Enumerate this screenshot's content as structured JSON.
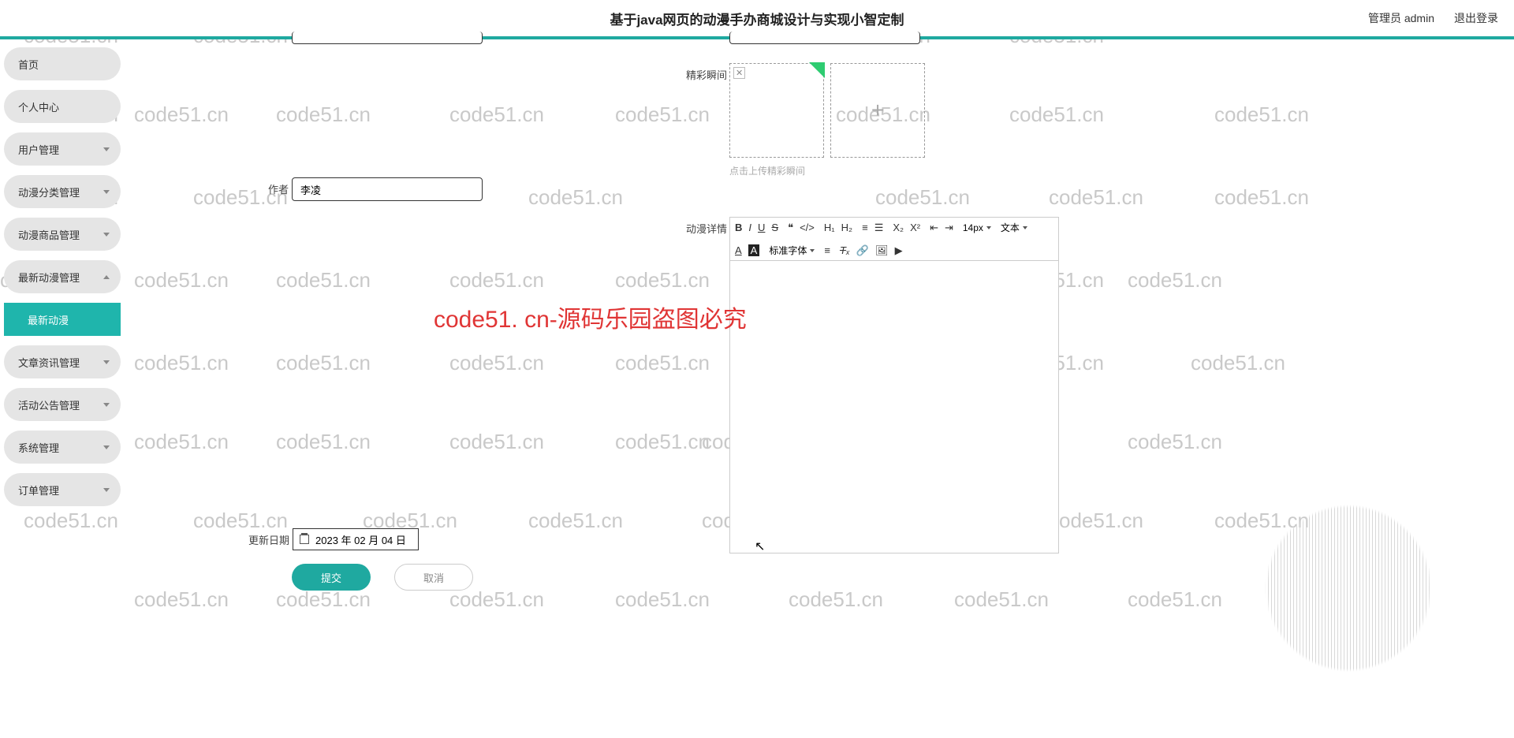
{
  "header": {
    "title": "基于java网页的动漫手办商城设计与实现小智定制",
    "admin": "管理员 admin",
    "logout": "退出登录"
  },
  "sidebar": {
    "items": [
      {
        "label": "首页",
        "expandable": false
      },
      {
        "label": "个人中心",
        "expandable": false
      },
      {
        "label": "用户管理",
        "expandable": true
      },
      {
        "label": "动漫分类管理",
        "expandable": true
      },
      {
        "label": "动漫商品管理",
        "expandable": true
      },
      {
        "label": "最新动漫管理",
        "expandable": true,
        "expanded": true
      },
      {
        "label": "文章资讯管理",
        "expandable": true
      },
      {
        "label": "活动公告管理",
        "expandable": true
      },
      {
        "label": "系统管理",
        "expandable": true
      },
      {
        "label": "订单管理",
        "expandable": true
      }
    ],
    "sub_active": "最新动漫"
  },
  "form": {
    "author_label": "作者",
    "author_value": "李凌",
    "moments_label": "精彩瞬间",
    "upload_hint": "点击上传精彩瞬间",
    "details_label": "动漫详情",
    "update_date_label": "更新日期",
    "update_date_value": "2023 年 02 月 04 日",
    "submit": "提交",
    "cancel": "取消"
  },
  "editor": {
    "font_size": "14px",
    "text_style": "文本",
    "font_family": "标准字体"
  },
  "watermark": {
    "text": "code51.cn",
    "red": "code51. cn-源码乐园盗图必究"
  }
}
